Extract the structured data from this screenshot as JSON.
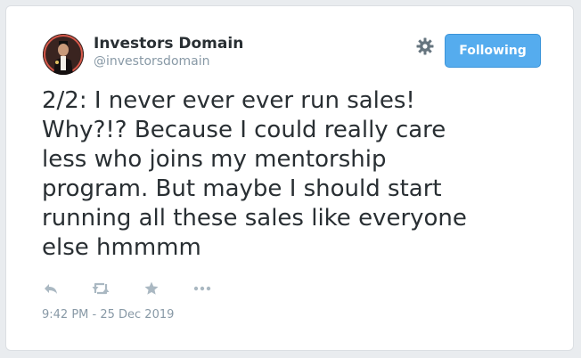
{
  "author": {
    "name": "Investors Domain",
    "handle": "@investorsdomain"
  },
  "follow_button": {
    "label": "Following"
  },
  "tweet": {
    "text": "2/2: I never ever ever run sales!\nWhy?!? Because I could really care\nless who joins my mentorship\nprogram. But maybe I should start\nrunning all these sales like everyone\nelse hmmmm",
    "timestamp": "9:42 PM - 25 Dec 2019"
  },
  "actions": [
    "reply-icon",
    "retweet-icon",
    "like-icon",
    "more-icon"
  ],
  "colors": {
    "accent": "#55acee",
    "text": "#292f33",
    "muted": "#8899a6",
    "icon": "#aab8c2"
  }
}
